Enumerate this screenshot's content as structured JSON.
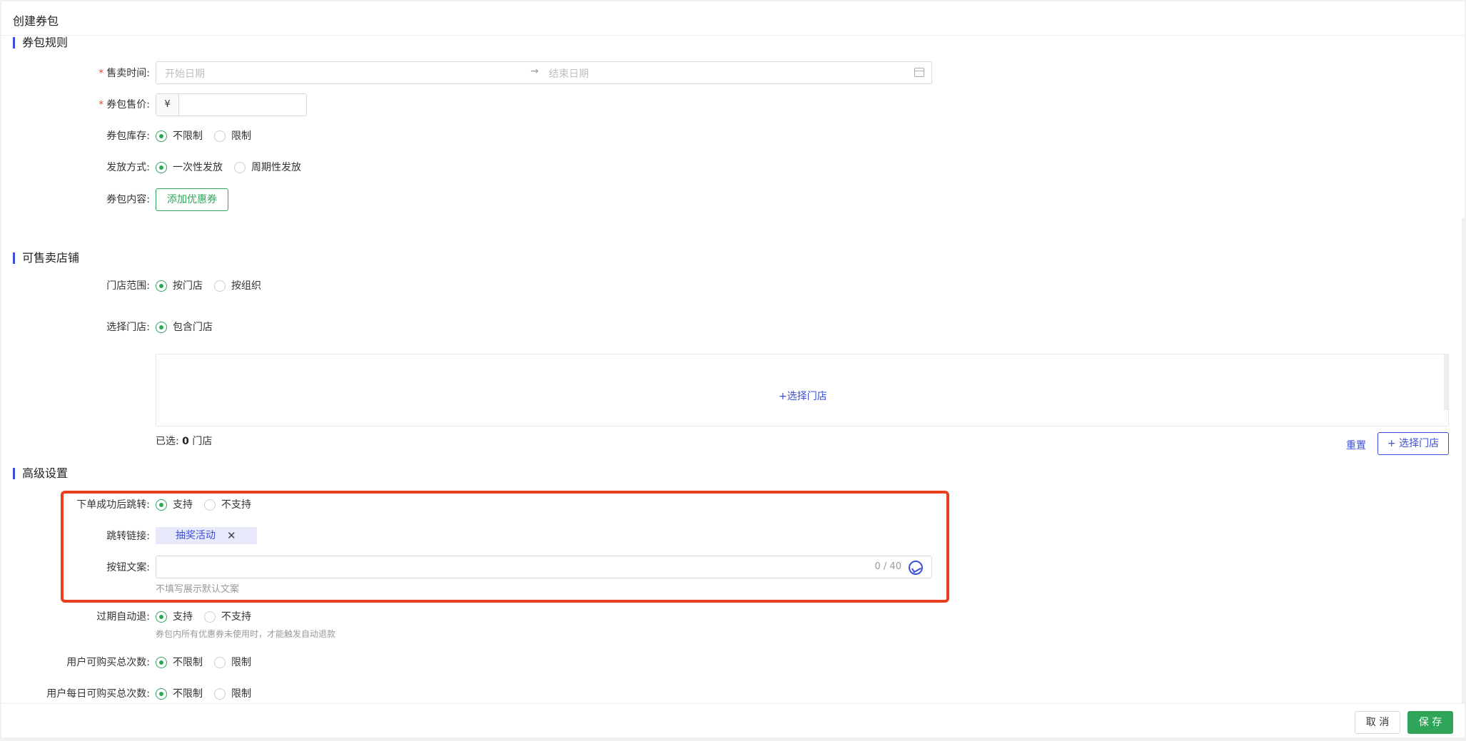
{
  "header": {
    "title": "创建券包"
  },
  "sections": {
    "rules": "券包规则",
    "stores": "可售卖店铺",
    "advanced": "高级设置"
  },
  "rules": {
    "sale_time": {
      "label": "售卖时间:",
      "required_mark": "*",
      "start_placeholder": "开始日期",
      "arrow": "→",
      "end_placeholder": "结束日期"
    },
    "price": {
      "label": "券包售价:",
      "required_mark": "*",
      "prefix": "¥",
      "value": ""
    },
    "stock": {
      "label": "券包库存:",
      "options": [
        "不限制",
        "限制"
      ],
      "selected": "不限制"
    },
    "issue": {
      "label": "发放方式:",
      "options": [
        "一次性发放",
        "周期性发放"
      ],
      "selected": "一次性发放"
    },
    "content": {
      "label": "券包内容:",
      "button": "添加优惠券"
    }
  },
  "stores": {
    "scope": {
      "label": "门店范围:",
      "options": [
        "按门店",
        "按组织"
      ],
      "selected": "按门店"
    },
    "select": {
      "label": "选择门店:",
      "options": [
        "包含门店"
      ],
      "selected": "包含门店"
    },
    "box_link": "+选择门店",
    "selected_prefix": "已选:",
    "selected_count": "0",
    "selected_suffix": "门店",
    "reset": "重置",
    "select_button": "+ 选择门店"
  },
  "advanced": {
    "jump": {
      "label": "下单成功后跳转:",
      "options": [
        "支持",
        "不支持"
      ],
      "selected": "支持"
    },
    "link": {
      "label": "跳转链接:",
      "tag": "抽奖活动",
      "close": "✕"
    },
    "button_text": {
      "label": "按钮文案:",
      "value": "",
      "counter": "0 / 40",
      "hint": "不填写展示默认文案"
    },
    "auto_refund": {
      "label": "过期自动退:",
      "options": [
        "支持",
        "不支持"
      ],
      "selected": "支持",
      "hint": "券包内所有优惠券未使用时，才能触发自动退款"
    },
    "total_limit": {
      "label": "用户可购买总次数:",
      "options": [
        "不限制",
        "限制"
      ],
      "selected": "不限制"
    },
    "daily_limit": {
      "label": "用户每日可购买总次数:",
      "options": [
        "不限制",
        "限制"
      ],
      "selected": "不限制"
    }
  },
  "footer": {
    "cancel": "取 消",
    "save": "保 存"
  },
  "colors": {
    "accent_green": "#2fa55a",
    "accent_blue": "#3b4fd8",
    "highlight_red": "#e8401c"
  }
}
